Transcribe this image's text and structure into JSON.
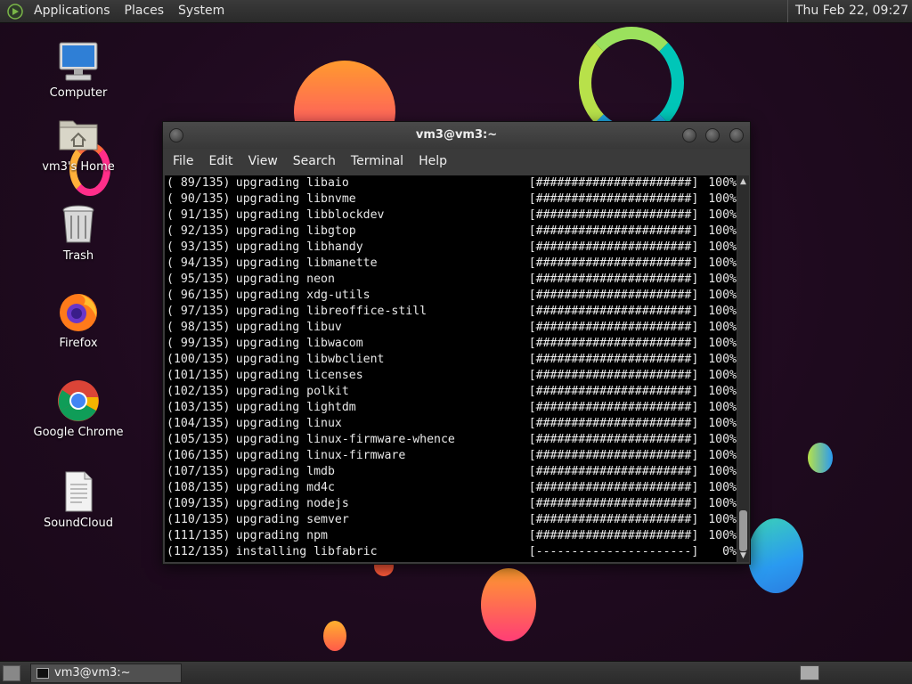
{
  "top_panel": {
    "menus": [
      "Applications",
      "Places",
      "System"
    ],
    "clock": "Thu Feb 22, 09:27"
  },
  "desktop_icons": [
    {
      "label": "Computer",
      "icon": "computer-icon"
    },
    {
      "label": "vm3's Home",
      "icon": "home-folder-icon"
    },
    {
      "label": "Trash",
      "icon": "trash-icon"
    },
    {
      "label": "Firefox",
      "icon": "firefox-icon"
    },
    {
      "label": "Google Chrome",
      "icon": "chrome-icon"
    },
    {
      "label": "SoundCloud",
      "icon": "document-icon"
    }
  ],
  "terminal": {
    "title": "vm3@vm3:~",
    "menu": [
      "File",
      "Edit",
      "View",
      "Search",
      "Terminal",
      "Help"
    ],
    "lines": [
      {
        "num": "( 89/135)",
        "action": "upgrading libaio",
        "bar": "[######################]",
        "pct": "100%"
      },
      {
        "num": "( 90/135)",
        "action": "upgrading libnvme",
        "bar": "[######################]",
        "pct": "100%"
      },
      {
        "num": "( 91/135)",
        "action": "upgrading libblockdev",
        "bar": "[######################]",
        "pct": "100%"
      },
      {
        "num": "( 92/135)",
        "action": "upgrading libgtop",
        "bar": "[######################]",
        "pct": "100%"
      },
      {
        "num": "( 93/135)",
        "action": "upgrading libhandy",
        "bar": "[######################]",
        "pct": "100%"
      },
      {
        "num": "( 94/135)",
        "action": "upgrading libmanette",
        "bar": "[######################]",
        "pct": "100%"
      },
      {
        "num": "( 95/135)",
        "action": "upgrading neon",
        "bar": "[######################]",
        "pct": "100%"
      },
      {
        "num": "( 96/135)",
        "action": "upgrading xdg-utils",
        "bar": "[######################]",
        "pct": "100%"
      },
      {
        "num": "( 97/135)",
        "action": "upgrading libreoffice-still",
        "bar": "[######################]",
        "pct": "100%"
      },
      {
        "num": "( 98/135)",
        "action": "upgrading libuv",
        "bar": "[######################]",
        "pct": "100%"
      },
      {
        "num": "( 99/135)",
        "action": "upgrading libwacom",
        "bar": "[######################]",
        "pct": "100%"
      },
      {
        "num": "(100/135)",
        "action": "upgrading libwbclient",
        "bar": "[######################]",
        "pct": "100%"
      },
      {
        "num": "(101/135)",
        "action": "upgrading licenses",
        "bar": "[######################]",
        "pct": "100%"
      },
      {
        "num": "(102/135)",
        "action": "upgrading polkit",
        "bar": "[######################]",
        "pct": "100%"
      },
      {
        "num": "(103/135)",
        "action": "upgrading lightdm",
        "bar": "[######################]",
        "pct": "100%"
      },
      {
        "num": "(104/135)",
        "action": "upgrading linux",
        "bar": "[######################]",
        "pct": "100%"
      },
      {
        "num": "(105/135)",
        "action": "upgrading linux-firmware-whence",
        "bar": "[######################]",
        "pct": "100%"
      },
      {
        "num": "(106/135)",
        "action": "upgrading linux-firmware",
        "bar": "[######################]",
        "pct": "100%"
      },
      {
        "num": "(107/135)",
        "action": "upgrading lmdb",
        "bar": "[######################]",
        "pct": "100%"
      },
      {
        "num": "(108/135)",
        "action": "upgrading md4c",
        "bar": "[######################]",
        "pct": "100%"
      },
      {
        "num": "(109/135)",
        "action": "upgrading nodejs",
        "bar": "[######################]",
        "pct": "100%"
      },
      {
        "num": "(110/135)",
        "action": "upgrading semver",
        "bar": "[######################]",
        "pct": "100%"
      },
      {
        "num": "(111/135)",
        "action": "upgrading npm",
        "bar": "[######################]",
        "pct": "100%"
      },
      {
        "num": "(112/135)",
        "action": "installing libfabric",
        "bar": "[----------------------]",
        "pct": "0%"
      }
    ]
  },
  "taskbar": {
    "window_button": "vm3@vm3:~"
  },
  "colors": {
    "desktop_bg": "#1e0a1e",
    "panel_bg": "#2f2f2f",
    "terminal_bg": "#000000",
    "terminal_fg": "#e8e8e8"
  }
}
